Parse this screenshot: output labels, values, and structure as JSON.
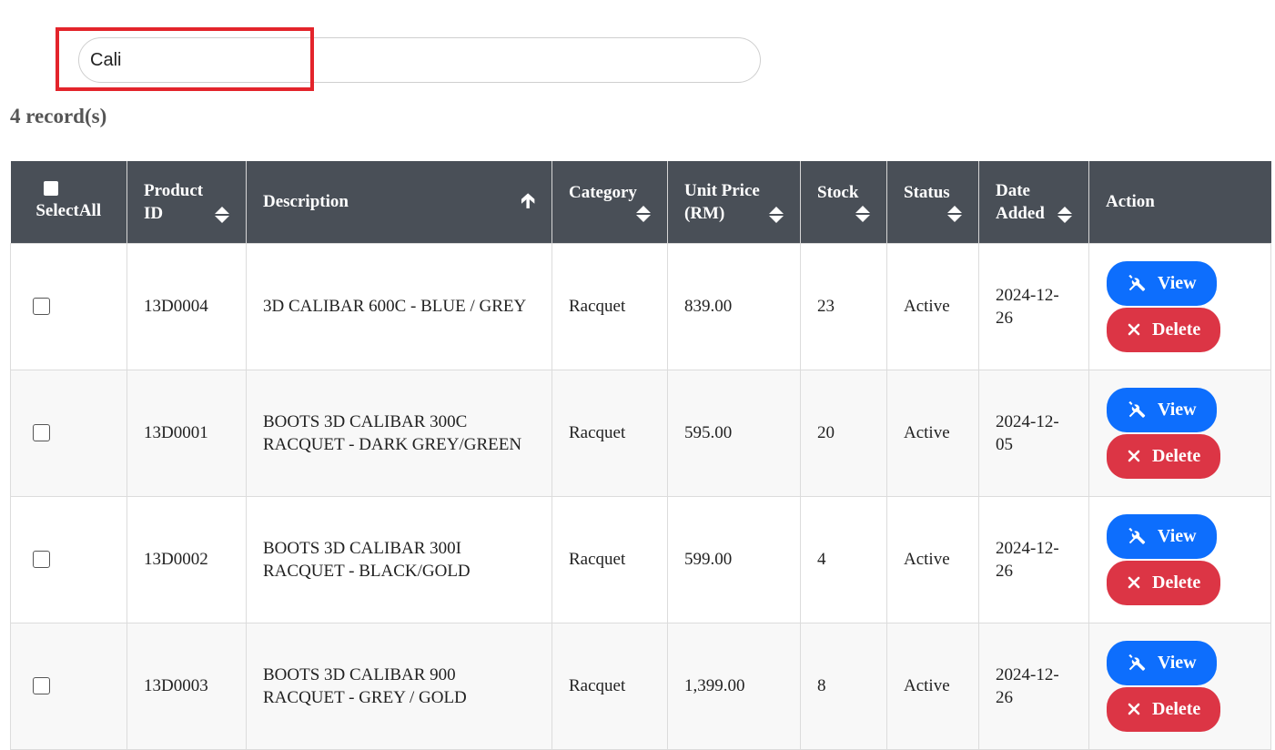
{
  "search": {
    "value": "Cali",
    "placeholder": ""
  },
  "summary": {
    "record_count": "4 record(s)"
  },
  "table": {
    "headers": {
      "select_all": "SelectAll",
      "product_id": "Product ID",
      "description": "Description",
      "category": "Category",
      "unit_price": "Unit Price (RM)",
      "stock": "Stock",
      "status": "Status",
      "date_added": "Date Added",
      "action": "Action"
    },
    "view_label": "View",
    "delete_label": "Delete",
    "rows": [
      {
        "product_id": "13D0004",
        "description": "3D CALIBAR 600C - BLUE / GREY",
        "category": "Racquet",
        "unit_price": "839.00",
        "stock": "23",
        "status": "Active",
        "date_added": "2024-12-26"
      },
      {
        "product_id": "13D0001",
        "description": "BOOTS 3D CALIBAR 300C RACQUET - DARK GREY/GREEN",
        "category": "Racquet",
        "unit_price": "595.00",
        "stock": "20",
        "status": "Active",
        "date_added": "2024-12-05"
      },
      {
        "product_id": "13D0002",
        "description": "BOOTS 3D CALIBAR 300I RACQUET - BLACK/GOLD",
        "category": "Racquet",
        "unit_price": "599.00",
        "stock": "4",
        "status": "Active",
        "date_added": "2024-12-26"
      },
      {
        "product_id": "13D0003",
        "description": "BOOTS 3D CALIBAR 900 RACQUET - GREY / GOLD",
        "category": "Racquet",
        "unit_price": "1,399.00",
        "stock": "8",
        "status": "Active",
        "date_added": "2024-12-26"
      }
    ]
  },
  "colors": {
    "header_bg": "#494f57",
    "view_button": "#0d6efd",
    "delete_button": "#dc3545",
    "highlight": "#e3242b"
  },
  "icons": {
    "view": "tools-icon",
    "delete": "x-icon",
    "sort": "sort-icon",
    "sorted_asc": "arrow-up-icon"
  }
}
